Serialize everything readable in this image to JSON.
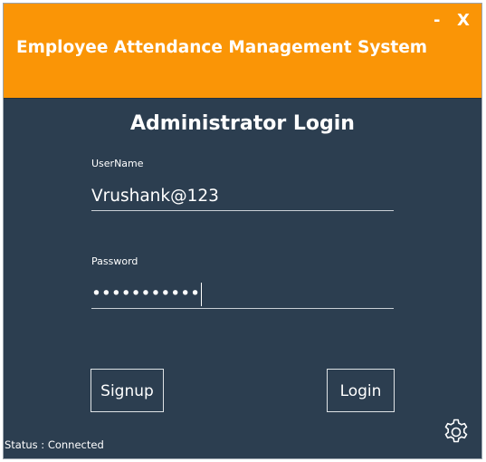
{
  "window": {
    "title": "Employee Attendance Management System",
    "minimize_label": "-",
    "close_label": "X"
  },
  "login": {
    "heading": "Administrator Login",
    "username_label": "UserName",
    "username_value": "Vrushank@123",
    "password_label": "Password",
    "password_mask": "•••••••••••"
  },
  "buttons": {
    "signup": "Signup",
    "login": "Login"
  },
  "status": {
    "text": "Status : Connected"
  },
  "icons": {
    "settings": "gear-icon"
  },
  "colors": {
    "header": "#fa9506",
    "background": "#2c3e50",
    "text": "#ffffff"
  }
}
